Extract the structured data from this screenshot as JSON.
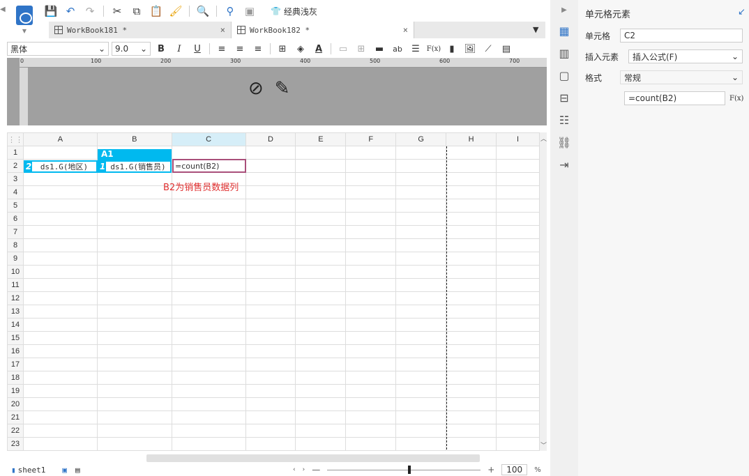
{
  "toolbar": {
    "theme_label": "经典浅灰"
  },
  "tabs": [
    {
      "label": "WorkBook181 *",
      "close": "×"
    },
    {
      "label": "WorkBook182 *",
      "close": "×"
    }
  ],
  "format_bar": {
    "font_family": "黑体",
    "font_size": "9.0",
    "bold": "B",
    "italic": "I",
    "underline": "U",
    "text_color": "A",
    "text_ab": "ab",
    "fx": "F(x)"
  },
  "ruler": {
    "ticks": [
      "0",
      "100",
      "200",
      "300",
      "400",
      "500",
      "600",
      "700"
    ]
  },
  "grid": {
    "columns": [
      "A",
      "B",
      "C",
      "D",
      "E",
      "F",
      "G",
      "H",
      "I"
    ],
    "rows": [
      "1",
      "2",
      "3",
      "4",
      "5",
      "6",
      "7",
      "8",
      "9",
      "10",
      "11",
      "12",
      "13",
      "14",
      "15",
      "16",
      "17",
      "18",
      "19",
      "20",
      "21",
      "22",
      "23"
    ],
    "cells": {
      "B1": "A1",
      "A2": "ds1.G(地区)",
      "B2": "ds1.G(销售员)",
      "C2": "=count(B2)",
      "A2_badge": "2",
      "B2_badge": "1"
    },
    "annotation": "B2为销售员数据列",
    "annotation_color": "#e03030",
    "accent": "#00b9ef"
  },
  "sheets": {
    "tab": "sheet1"
  },
  "zoom": {
    "minus": "—",
    "plus": "+",
    "value": "100",
    "unit": "%"
  },
  "panel": {
    "title": "单元格元素",
    "cell_label": "单元格",
    "cell_value": "C2",
    "insert_label": "插入元素",
    "insert_value": "插入公式(F)",
    "format_label": "格式",
    "format_value": "常规",
    "formula_value": "=count(B2)",
    "fx_button": "F(x)"
  }
}
